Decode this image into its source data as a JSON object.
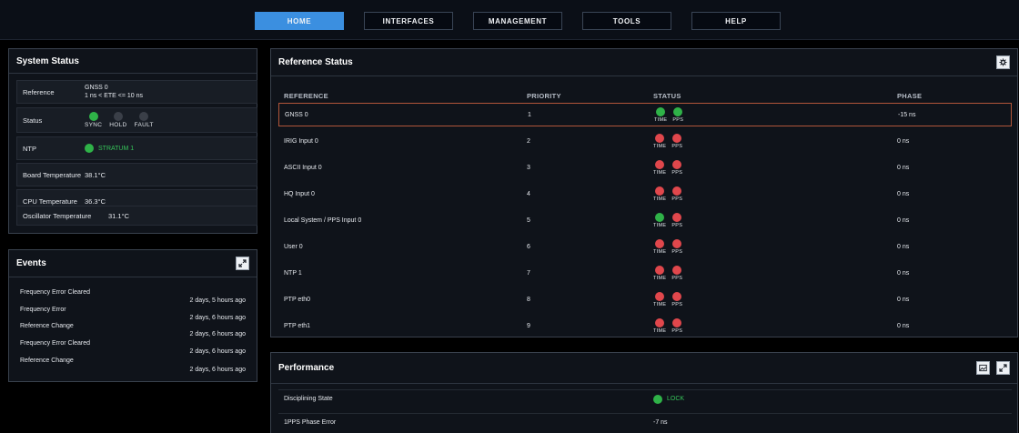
{
  "nav": [
    "HOME",
    "INTERFACES",
    "MANAGEMENT",
    "TOOLS",
    "HELP"
  ],
  "nav_active": "HOME",
  "system_status": {
    "title": "System Status",
    "reference_label": "Reference",
    "reference_value_line1": "GNSS 0",
    "reference_value_line2": "1 ns < ETE <= 10 ns",
    "status_label": "Status",
    "status_leds": [
      {
        "label": "SYNC",
        "state": "green"
      },
      {
        "label": "HOLD",
        "state": "off"
      },
      {
        "label": "FAULT",
        "state": "off"
      }
    ],
    "ntp_label": "NTP",
    "ntp_value": "STRATUM 1",
    "board_temp_label": "Board Temperature",
    "board_temp_value": "38.1°C",
    "cpu_temp_label": "CPU Temperature",
    "cpu_temp_value": "36.3°C",
    "osc_temp_label": "Oscillator Temperature",
    "osc_temp_value": "31.1°C"
  },
  "events": {
    "title": "Events",
    "labels": [
      "Frequency Error Cleared",
      "Frequency Error",
      "Reference Change",
      "Frequency Error Cleared",
      "Reference Change"
    ],
    "times": [
      "2 days, 5 hours ago",
      "2 days, 6 hours ago",
      "2 days, 6 hours ago",
      "2 days, 6 hours ago",
      "2 days, 6 hours ago"
    ]
  },
  "reference_status": {
    "title": "Reference Status",
    "headers": {
      "reference": "REFERENCE",
      "priority": "PRIORITY",
      "status": "STATUS",
      "phase": "PHASE"
    },
    "time_label": "TIME",
    "pps_label": "PPS",
    "rows": [
      {
        "reference": "GNSS 0",
        "priority": "1",
        "time": "green",
        "pps": "green",
        "phase": "-15 ns"
      },
      {
        "reference": "IRIG Input 0",
        "priority": "2",
        "time": "red",
        "pps": "red",
        "phase": "0 ns"
      },
      {
        "reference": "ASCII Input 0",
        "priority": "3",
        "time": "red",
        "pps": "red",
        "phase": "0 ns"
      },
      {
        "reference": "HQ Input 0",
        "priority": "4",
        "time": "red",
        "pps": "red",
        "phase": "0 ns"
      },
      {
        "reference": "Local System / PPS Input 0",
        "priority": "5",
        "time": "green",
        "pps": "red",
        "phase": "0 ns"
      },
      {
        "reference": "User 0",
        "priority": "6",
        "time": "red",
        "pps": "red",
        "phase": "0 ns"
      },
      {
        "reference": "NTP 1",
        "priority": "7",
        "time": "red",
        "pps": "red",
        "phase": "0 ns"
      },
      {
        "reference": "PTP eth0",
        "priority": "8",
        "time": "red",
        "pps": "red",
        "phase": "0 ns"
      },
      {
        "reference": "PTP eth1",
        "priority": "9",
        "time": "red",
        "pps": "red",
        "phase": "0 ns"
      }
    ]
  },
  "performance": {
    "title": "Performance",
    "disciplining_label": "Disciplining State",
    "disciplining_value": "LOCK",
    "pps_error_label": "1PPS Phase Error",
    "pps_error_value": "-7 ns"
  },
  "colors": {
    "accent": "#3b8fe0",
    "green": "#2fb248",
    "red": "#e0474c",
    "off": "#3a3f48"
  }
}
